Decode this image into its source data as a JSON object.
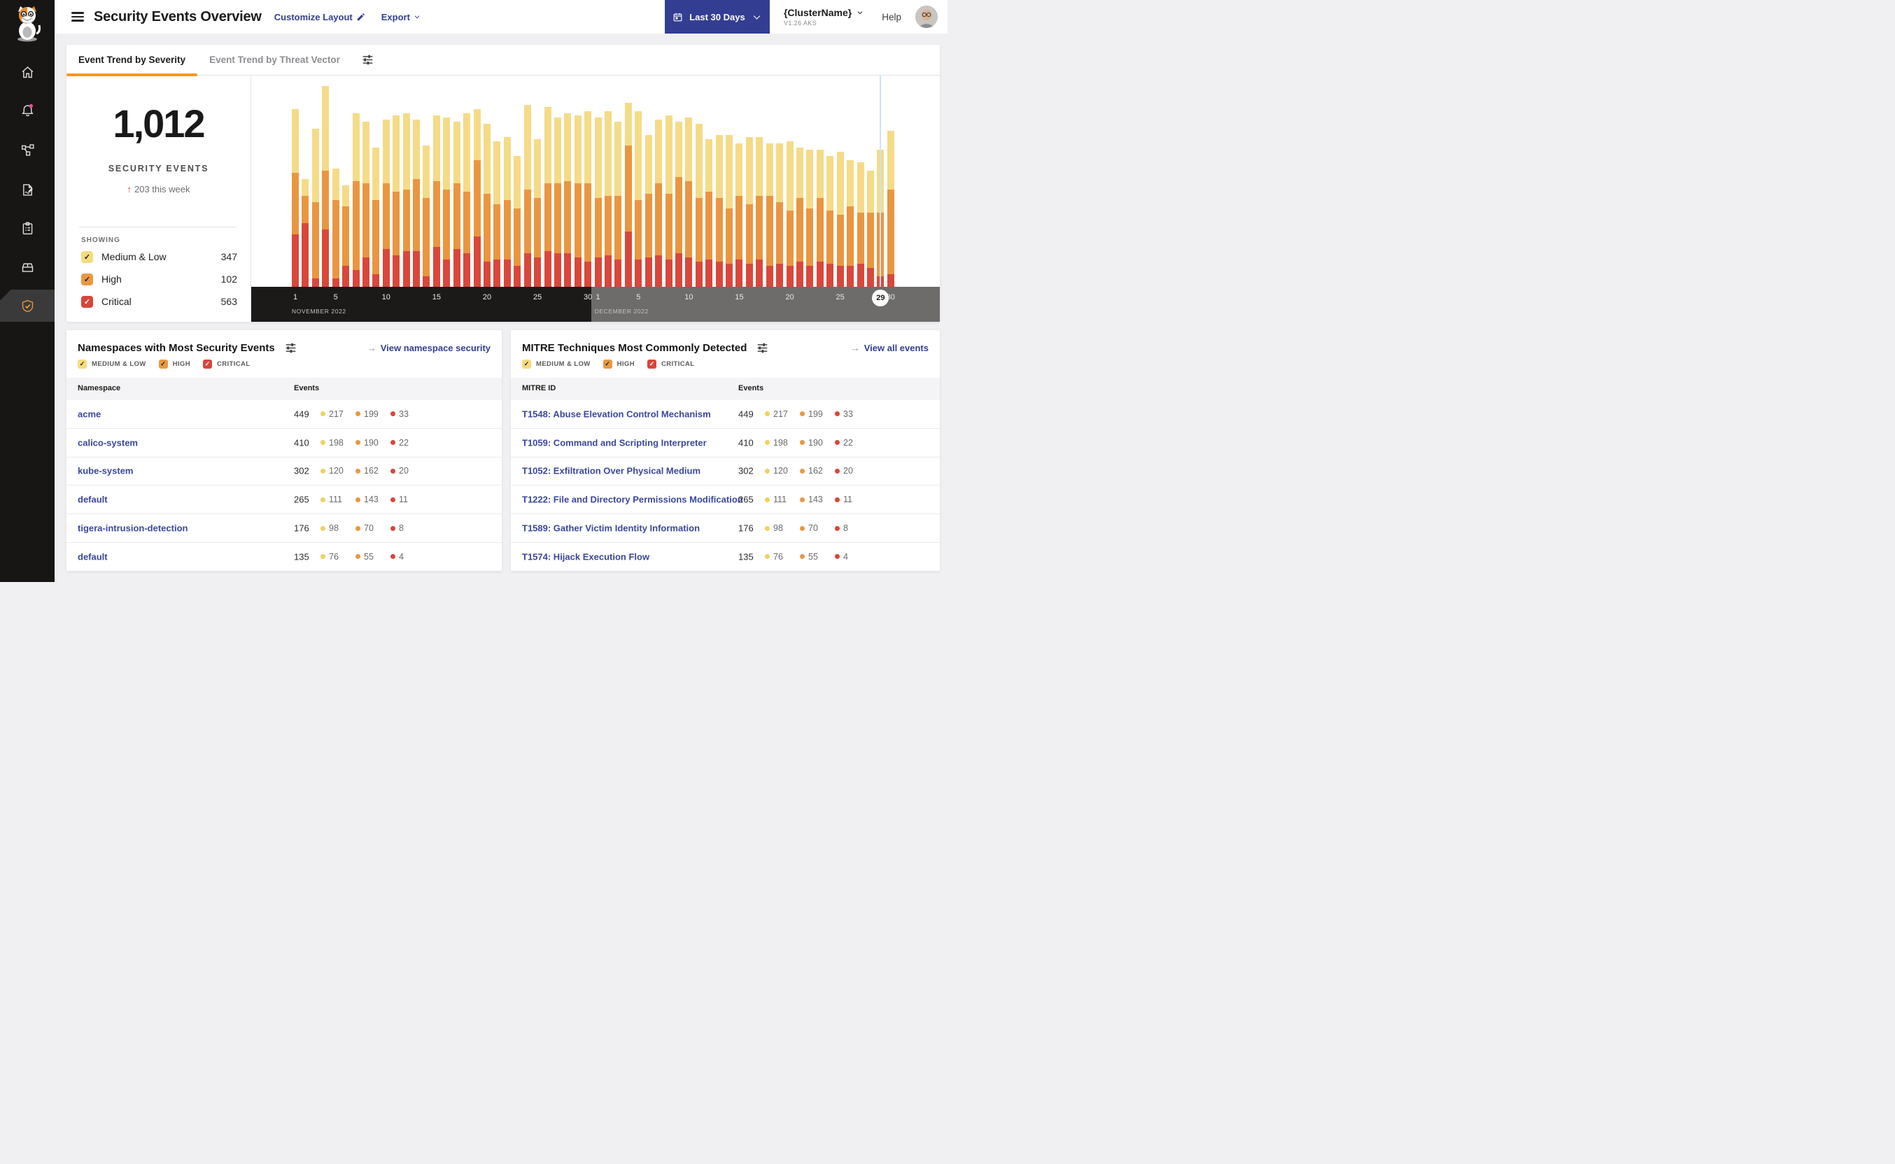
{
  "header": {
    "title": "Security Events Overview",
    "customize_layout": "Customize Layout",
    "export": "Export",
    "date_range": "Last 30 Days",
    "cluster_name": "{ClusterName}",
    "cluster_version": "V1.26 AKS",
    "help": "Help"
  },
  "tabs": [
    {
      "label": "Event Trend by Severity",
      "active": true
    },
    {
      "label": "Event Trend by Threat Vector",
      "active": false
    }
  ],
  "summary": {
    "total": "1,012",
    "total_label": "SECURITY EVENTS",
    "delta_arrow": "↑",
    "delta": "203 this week",
    "showing_label": "SHOWING",
    "legend": [
      {
        "label": "Medium & Low",
        "count": "347",
        "color": "#F5DB7E"
      },
      {
        "label": "High",
        "count": "102",
        "color": "#E9983F"
      },
      {
        "label": "Critical",
        "count": "563",
        "color": "#D9453A"
      }
    ]
  },
  "severity_filters": [
    "MEDIUM & LOW",
    "HIGH",
    "CRITICAL"
  ],
  "colors": {
    "accent_orange": "#F6981E",
    "navy": "#333E92",
    "link": "#3A479B",
    "medium_low": "#F5DB87",
    "high": "#EA9640",
    "critical": "#D9473B",
    "band_november": "#1B1A19",
    "band_december": "#6E6C6A",
    "highlight_line": "#C9E4F2",
    "notification_dot": "#EE4D9B"
  },
  "chart_data": {
    "type": "bar",
    "stacked": true,
    "title": "Event Trend by Severity",
    "series_names": [
      "Critical",
      "High",
      "Medium & Low"
    ],
    "units": "percent of plot height (no numeric y-axis shown)",
    "legend_position": "left panel",
    "grid": false,
    "months": [
      {
        "label": "NOVEMBER 2022",
        "days": 30,
        "ticks": [
          1,
          5,
          10,
          15,
          20,
          25,
          30
        ]
      },
      {
        "label": "DECEMBER 2022",
        "days": 30,
        "ticks": [
          1,
          5,
          10,
          15,
          20,
          25,
          30
        ]
      }
    ],
    "highlighted_day": {
      "month": "DECEMBER 2022",
      "day": 29
    },
    "bars": [
      {
        "d": "Nov 1",
        "ml": 30,
        "h": 29,
        "c": 25
      },
      {
        "d": "Nov 2",
        "ml": 8,
        "h": 13,
        "c": 30
      },
      {
        "d": "Nov 3",
        "ml": 35,
        "h": 36,
        "c": 4
      },
      {
        "d": "Nov 4",
        "ml": 40,
        "h": 28,
        "c": 27
      },
      {
        "d": "Nov 5",
        "ml": 15,
        "h": 37,
        "c": 4
      },
      {
        "d": "Nov 6",
        "ml": 10,
        "h": 28,
        "c": 10
      },
      {
        "d": "Nov 7",
        "ml": 32,
        "h": 42,
        "c": 8
      },
      {
        "d": "Nov 8",
        "ml": 29,
        "h": 35,
        "c": 14
      },
      {
        "d": "Nov 9",
        "ml": 25,
        "h": 35,
        "c": 6
      },
      {
        "d": "Nov 10",
        "ml": 30,
        "h": 31,
        "c": 18
      },
      {
        "d": "Nov 11",
        "ml": 36,
        "h": 30,
        "c": 15
      },
      {
        "d": "Nov 12",
        "ml": 36,
        "h": 29,
        "c": 17
      },
      {
        "d": "Nov 13",
        "ml": 28,
        "h": 34,
        "c": 17
      },
      {
        "d": "Nov 14",
        "ml": 25,
        "h": 37,
        "c": 5
      },
      {
        "d": "Nov 15",
        "ml": 31,
        "h": 31,
        "c": 19
      },
      {
        "d": "Nov 16",
        "ml": 34,
        "h": 33,
        "c": 13
      },
      {
        "d": "Nov 17",
        "ml": 29,
        "h": 31,
        "c": 18
      },
      {
        "d": "Nov 18",
        "ml": 37,
        "h": 29,
        "c": 16
      },
      {
        "d": "Nov 19",
        "ml": 24,
        "h": 36,
        "c": 24
      },
      {
        "d": "Nov 20",
        "ml": 33,
        "h": 32,
        "c": 12
      },
      {
        "d": "Nov 21",
        "ml": 30,
        "h": 26,
        "c": 13
      },
      {
        "d": "Nov 22",
        "ml": 30,
        "h": 28,
        "c": 13
      },
      {
        "d": "Nov 23",
        "ml": 25,
        "h": 27,
        "c": 10
      },
      {
        "d": "Nov 24",
        "ml": 40,
        "h": 30,
        "c": 16
      },
      {
        "d": "Nov 25",
        "ml": 28,
        "h": 28,
        "c": 14
      },
      {
        "d": "Nov 26",
        "ml": 36,
        "h": 32,
        "c": 17
      },
      {
        "d": "Nov 27",
        "ml": 31,
        "h": 33,
        "c": 16
      },
      {
        "d": "Nov 28",
        "ml": 32,
        "h": 34,
        "c": 16
      },
      {
        "d": "Nov 29",
        "ml": 32,
        "h": 35,
        "c": 14
      },
      {
        "d": "Nov 30",
        "ml": 34,
        "h": 37,
        "c": 12
      },
      {
        "d": "Dec 1",
        "ml": 38,
        "h": 28,
        "c": 14
      },
      {
        "d": "Dec 2",
        "ml": 40,
        "h": 28,
        "c": 15
      },
      {
        "d": "Dec 3",
        "ml": 35,
        "h": 30,
        "c": 13
      },
      {
        "d": "Dec 4",
        "ml": 20,
        "h": 41,
        "c": 26
      },
      {
        "d": "Dec 5",
        "ml": 42,
        "h": 28,
        "c": 13
      },
      {
        "d": "Dec 6",
        "ml": 28,
        "h": 30,
        "c": 14
      },
      {
        "d": "Dec 7",
        "ml": 30,
        "h": 34,
        "c": 15
      },
      {
        "d": "Dec 8",
        "ml": 37,
        "h": 31,
        "c": 13
      },
      {
        "d": "Dec 9",
        "ml": 26,
        "h": 36,
        "c": 16
      },
      {
        "d": "Dec 10",
        "ml": 30,
        "h": 36,
        "c": 14
      },
      {
        "d": "Dec 11",
        "ml": 35,
        "h": 30,
        "c": 12
      },
      {
        "d": "Dec 12",
        "ml": 25,
        "h": 32,
        "c": 13
      },
      {
        "d": "Dec 13",
        "ml": 30,
        "h": 30,
        "c": 12
      },
      {
        "d": "Dec 14",
        "ml": 35,
        "h": 26,
        "c": 11
      },
      {
        "d": "Dec 15",
        "ml": 25,
        "h": 30,
        "c": 13
      },
      {
        "d": "Dec 16",
        "ml": 32,
        "h": 28,
        "c": 11
      },
      {
        "d": "Dec 17",
        "ml": 28,
        "h": 30,
        "c": 13
      },
      {
        "d": "Dec 18",
        "ml": 25,
        "h": 33,
        "c": 10
      },
      {
        "d": "Dec 19",
        "ml": 28,
        "h": 29,
        "c": 11
      },
      {
        "d": "Dec 20",
        "ml": 33,
        "h": 26,
        "c": 10
      },
      {
        "d": "Dec 21",
        "ml": 24,
        "h": 30,
        "c": 12
      },
      {
        "d": "Dec 22",
        "ml": 28,
        "h": 27,
        "c": 10
      },
      {
        "d": "Dec 23",
        "ml": 23,
        "h": 30,
        "c": 12
      },
      {
        "d": "Dec 24",
        "ml": 26,
        "h": 25,
        "c": 11
      },
      {
        "d": "Dec 25",
        "ml": 30,
        "h": 24,
        "c": 10
      },
      {
        "d": "Dec 26",
        "ml": 22,
        "h": 28,
        "c": 10
      },
      {
        "d": "Dec 27",
        "ml": 24,
        "h": 24,
        "c": 11
      },
      {
        "d": "Dec 28",
        "ml": 20,
        "h": 26,
        "c": 9
      },
      {
        "d": "Dec 29",
        "ml": 30,
        "h": 30,
        "c": 5
      },
      {
        "d": "Dec 30",
        "ml": 28,
        "h": 40,
        "c": 6
      }
    ]
  },
  "tables": [
    {
      "title": "Namespaces with Most Security Events",
      "link": "View namespace security",
      "link_arrow": "→",
      "col1": "Namespace",
      "col2": "Events",
      "rows": [
        {
          "name": "acme",
          "total": "449",
          "medium_low": "217",
          "high": "199",
          "critical": "33"
        },
        {
          "name": "calico-system",
          "total": "410",
          "medium_low": "198",
          "high": "190",
          "critical": "22"
        },
        {
          "name": "kube-system",
          "total": "302",
          "medium_low": "120",
          "high": "162",
          "critical": "20"
        },
        {
          "name": "default",
          "total": "265",
          "medium_low": "111",
          "high": "143",
          "critical": "11"
        },
        {
          "name": "tigera-intrusion-detection",
          "total": "176",
          "medium_low": "98",
          "high": "70",
          "critical": "8"
        },
        {
          "name": "default",
          "total": "135",
          "medium_low": "76",
          "high": "55",
          "critical": "4"
        }
      ]
    },
    {
      "title": "MITRE Techniques Most Commonly Detected",
      "link": "View all events",
      "link_arrow": "→",
      "col1": "MITRE ID",
      "col2": "Events",
      "rows": [
        {
          "name": "T1548: Abuse Elevation Control Mechanism",
          "total": "449",
          "medium_low": "217",
          "high": "199",
          "critical": "33"
        },
        {
          "name": "T1059: Command and Scripting Interpreter",
          "total": "410",
          "medium_low": "198",
          "high": "190",
          "critical": "22"
        },
        {
          "name": "T1052: Exfiltration Over Physical Medium",
          "total": "302",
          "medium_low": "120",
          "high": "162",
          "critical": "20"
        },
        {
          "name": "T1222: File and Directory Permissions Modification",
          "total": "265",
          "medium_low": "111",
          "high": "143",
          "critical": "11"
        },
        {
          "name": "T1589: Gather Victim Identity Information",
          "total": "176",
          "medium_low": "98",
          "high": "70",
          "critical": "8"
        },
        {
          "name": "T1574: Hijack Execution Flow",
          "total": "135",
          "medium_low": "76",
          "high": "55",
          "critical": "4"
        }
      ]
    }
  ]
}
